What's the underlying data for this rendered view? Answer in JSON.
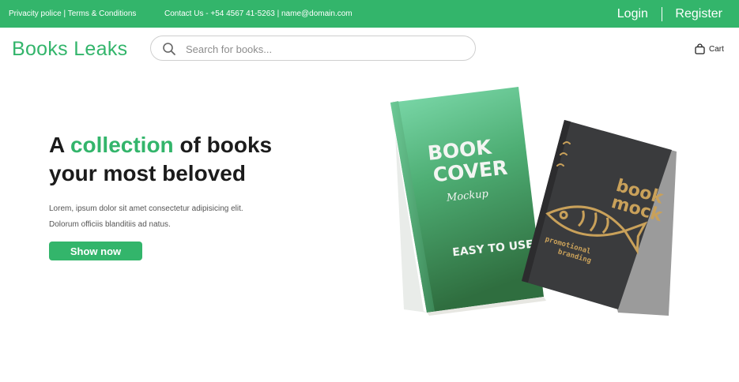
{
  "topbar": {
    "privacy_link": "Privacity police",
    "separator": "|",
    "terms_link": "Terms & Conditions",
    "contact_prefix": "Contact Us - ",
    "phone": "+54 4567 41-5263",
    "email": "name@domain.com",
    "login_label": "Login",
    "register_label": "Register"
  },
  "header": {
    "logo": "Books Leaks",
    "search_placeholder": "Search for books...",
    "search_value": "",
    "cart_label": "Cart"
  },
  "hero": {
    "title_prefix": "A ",
    "title_accent": "collection",
    "title_suffix": " of books",
    "title_line2": "your most beloved",
    "desc_line1": "Lorem, ipsum dolor sit amet consectetur adipisicing elit.",
    "desc_line2": "Dolorum officiis blanditiis ad natus.",
    "cta_label": "Show now"
  },
  "artwork": {
    "green_book_title_1": "BOOK",
    "green_book_title_2": "COVER",
    "green_book_script": "Mockup",
    "green_book_tagline": "EASY TO USE",
    "dark_book_title_1": "book",
    "dark_book_title_2": "mock",
    "dark_book_tagline_1": "promotional",
    "dark_book_tagline_2": "branding"
  },
  "colors": {
    "brand": "#33b56b",
    "text": "#1b1b1b",
    "muted": "#555555",
    "dark_book": "#3a3b3d",
    "gold": "#c9a15a"
  },
  "icons": {
    "search": "search-icon",
    "cart": "shopping-bag-icon",
    "book_art": "fish-icon"
  }
}
